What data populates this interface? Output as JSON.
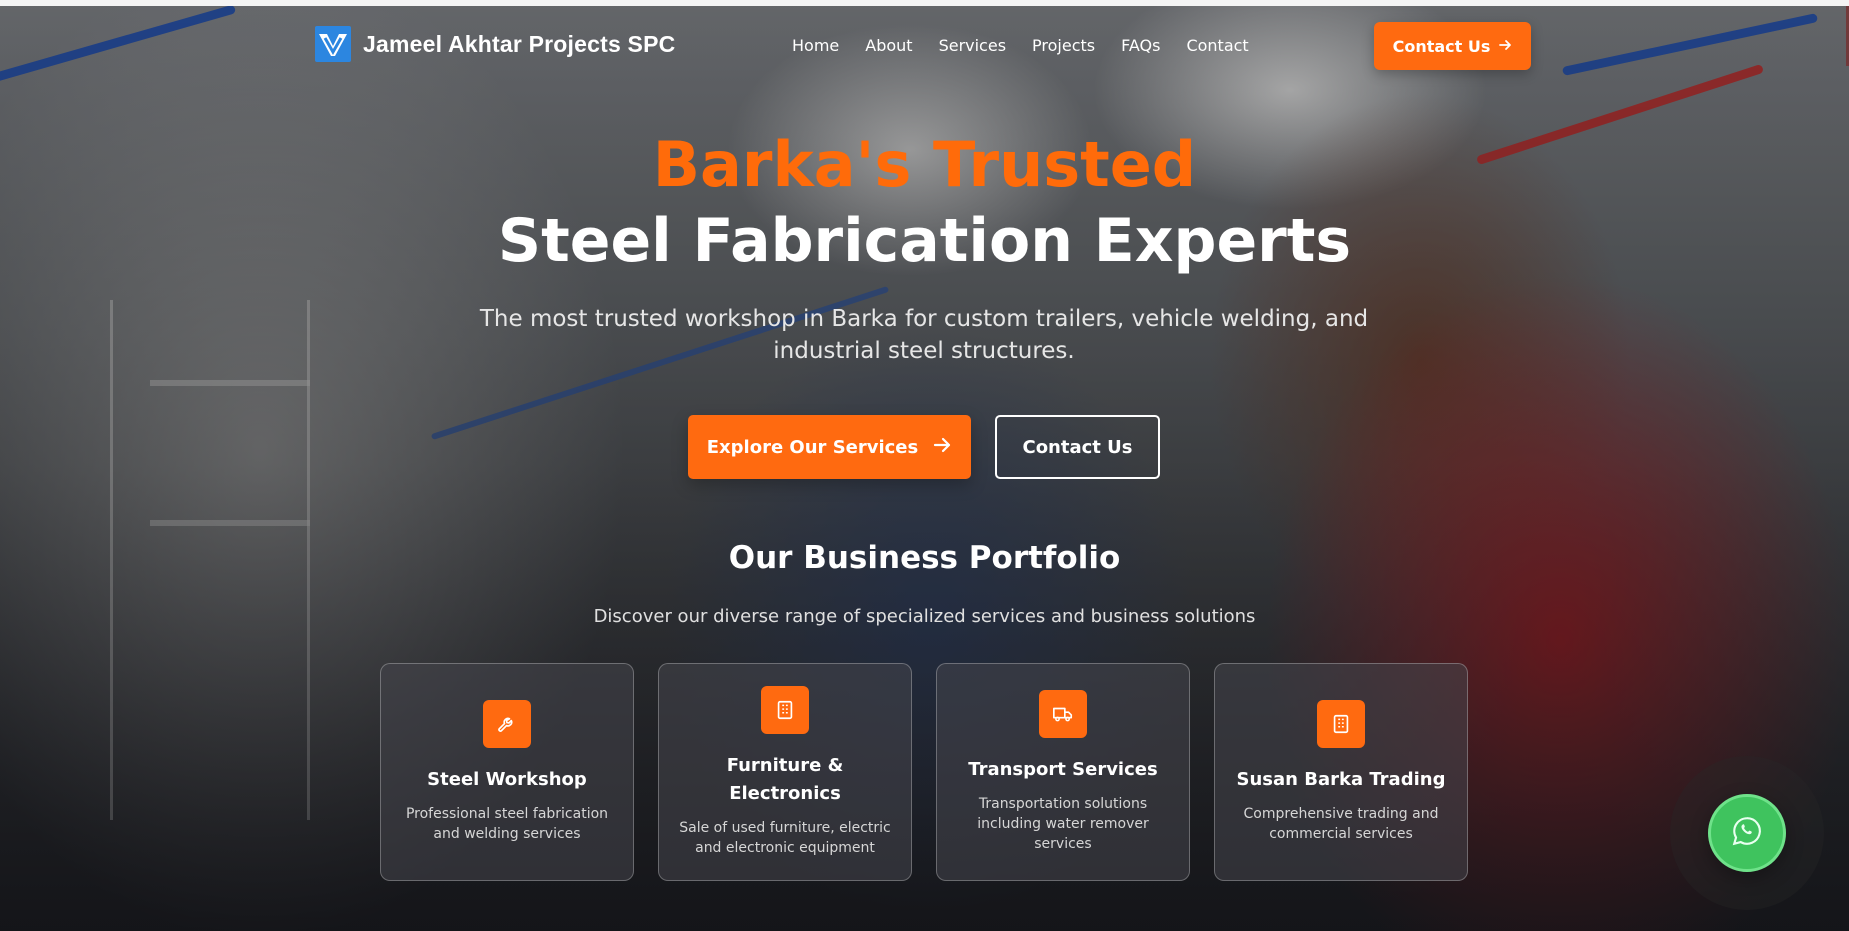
{
  "header": {
    "brand": "Jameel Akhtar Projects SPC",
    "nav": [
      "Home",
      "About",
      "Services",
      "Projects",
      "FAQs",
      "Contact"
    ],
    "cta": "Contact Us"
  },
  "hero": {
    "title_accent": "Barka's Trusted",
    "title_main": "Steel Fabrication Experts",
    "subtitle": "The most trusted workshop in Barka for custom trailers, vehicle welding, and industrial steel structures.",
    "primary_button": "Explore Our Services",
    "secondary_button": "Contact Us"
  },
  "portfolio": {
    "title": "Our Business Portfolio",
    "subtitle": "Discover our diverse range of specialized services and business solutions",
    "cards": [
      {
        "title": "Steel Workshop",
        "desc": "Professional steel fabrication and welding services",
        "icon": "wrench-icon"
      },
      {
        "title": "Furniture & Electronics",
        "desc": "Sale of used furniture, electric and electronic equipment",
        "icon": "building-icon"
      },
      {
        "title": "Transport Services",
        "desc": "Transportation solutions including water remover services",
        "icon": "truck-icon"
      },
      {
        "title": "Susan Barka Trading",
        "desc": "Comprehensive trading and commercial services",
        "icon": "building-icon"
      }
    ]
  },
  "colors": {
    "accent": "#ff6a10",
    "logo_blue": "#2c86e0",
    "whatsapp": "#3fc35e"
  }
}
